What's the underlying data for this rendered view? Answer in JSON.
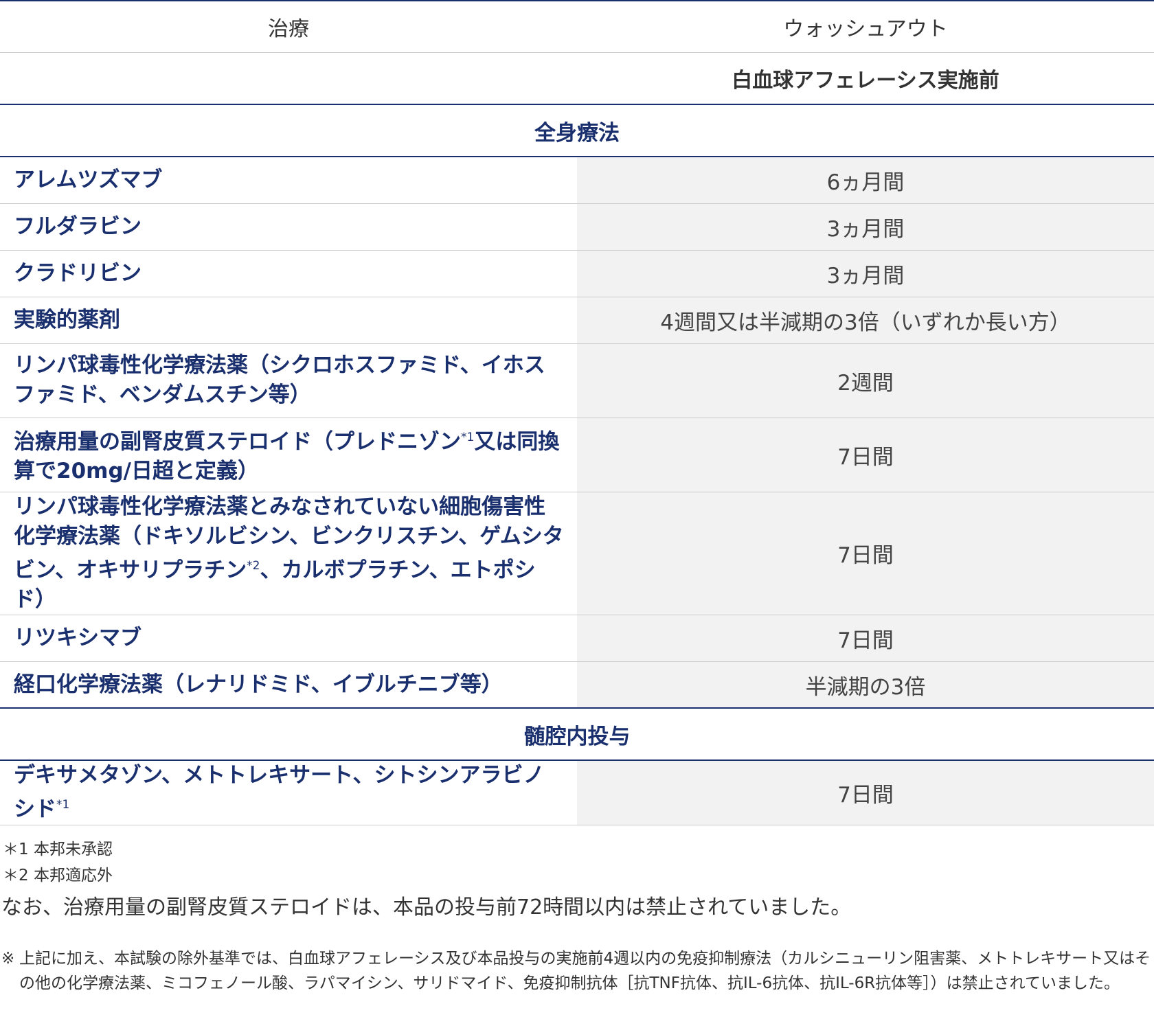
{
  "table": {
    "header": {
      "col1": "治療",
      "col2": "ウォッシュアウト",
      "col2_sub": "白血球アフェレーシス実施前"
    },
    "sections": [
      {
        "title": "全身療法",
        "rows": [
          {
            "name": "アレムツズマブ",
            "value": "6ヵ月間"
          },
          {
            "name": "フルダラビン",
            "value": "3ヵ月間"
          },
          {
            "name": "クラドリビン",
            "value": "3ヵ月間"
          },
          {
            "name": "実験的薬剤",
            "value": "4週間又は半減期の3倍（いずれか長い方）"
          },
          {
            "name": "リンパ球毒性化学療法薬（シクロホスファミド、イホスファミド、ベンダムスチン等）",
            "value": "2週間"
          },
          {
            "name_pre": "治療用量の副腎皮質ステロイド（プレドニゾン",
            "name_note": "*1",
            "name_post": "又は同換算で20mg/日超と定義）",
            "value": "7日間"
          },
          {
            "name_pre": "リンパ球毒性化学療法薬とみなされていない細胞傷害性化学療法薬（ドキソルビシン、ビンクリスチン、ゲムシタビン、オキサリプラチン",
            "name_note": "*2",
            "name_post": "、カルボプラチン、エトポシド）",
            "value": "7日間"
          },
          {
            "name": "リツキシマブ",
            "value": "7日間"
          },
          {
            "name": "経口化学療法薬（レナリドミド、イブルチニブ等）",
            "value": "半減期の3倍"
          }
        ]
      },
      {
        "title": "髄腔内投与",
        "rows": [
          {
            "name_pre": "デキサメタゾン、メトトレキサート、シトシンアラビノシド",
            "name_note": "*1",
            "value": "7日間"
          }
        ]
      }
    ]
  },
  "footnotes": [
    "＊1 本邦未承認",
    "＊2 本邦適応外"
  ],
  "remark": "なお、治療用量の副腎皮質ステロイドは、本品の投与前72時間以内は禁止されていました。",
  "caveat": {
    "mark": "※",
    "text": "上記に加え、本試験の除外基準では、白血球アフェレーシス及び本品投与の実施前4週以内の免疫抑制療法（カルシニューリン阻害薬、メトトレキサート又はその他の化学療法薬、ミコフェノール酸、ラパマイシン、サリドマイド、免疫抑制抗体［抗TNF抗体、抗IL-6抗体、抗IL-6R抗体等］）は禁止されていました。"
  }
}
